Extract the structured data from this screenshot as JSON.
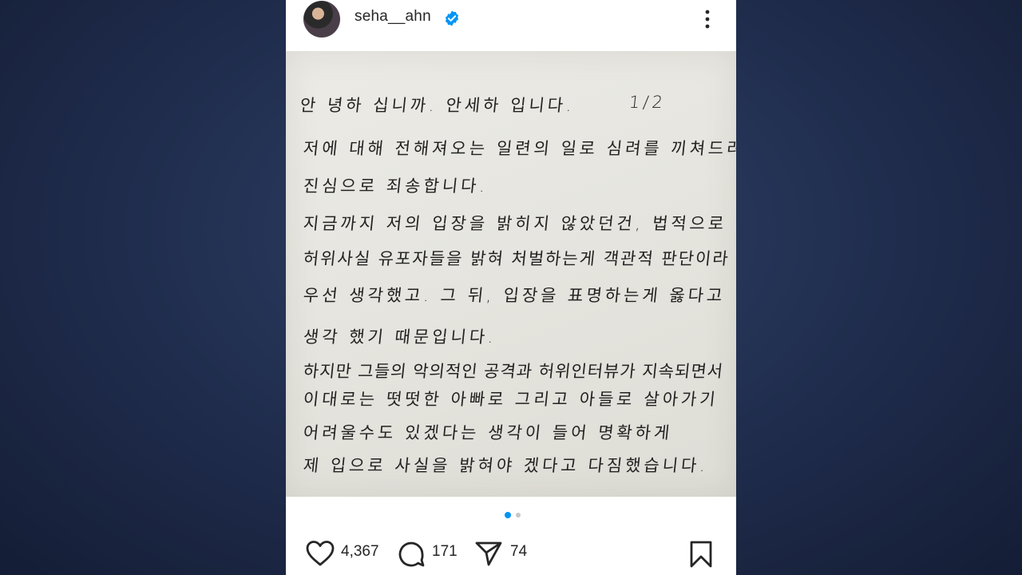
{
  "post": {
    "username": "seha__ahn",
    "verified": true
  },
  "letter": {
    "lines": [
      "안 녕하 십니까. 안세하 입니다.",
      "1/2",
      "저에 대해 전해져오는 일련의 일로 심려를 끼쳐드려",
      "진심으로 죄송합니다.",
      "지금까지 저의 입장을 밝히지 않았던건, 법적으로",
      "허위사실 유포자들을 밝혀 처벌하는게 객관적 판단이라",
      "우선 생각했고. 그 뒤, 입장을 표명하는게 옳다고",
      "생각 했기 때문입니다.",
      "하지만 그들의 악의적인 공격과 허위인터뷰가 지속되면서",
      "이대로는 떳떳한 아빠로 그리고 아들로 살아가기",
      "어려울수도 있겠다는 생각이 들어 명확하게",
      "제 입으로 사실을 밝혀야 겠다고 다짐했습니다."
    ]
  },
  "carousel": {
    "total": 2,
    "current": 1,
    "active_color": "#0095f6",
    "inactive_color": "#c7c7c7"
  },
  "actions": {
    "likes": "4,367",
    "comments": "171",
    "shares": "74"
  },
  "icons": {
    "like": "heart-icon",
    "comment": "comment-bubble-icon",
    "share": "paper-plane-icon",
    "save": "bookmark-icon",
    "more": "more-vertical-icon",
    "verified": "verified-badge-icon"
  },
  "colors": {
    "verified_badge": "#0095f6",
    "background": "#1f2c4c"
  }
}
